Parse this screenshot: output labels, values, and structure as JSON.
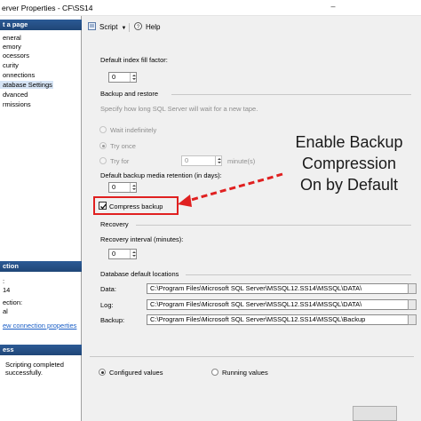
{
  "window": {
    "title": "erver Properties - CF\\SS14",
    "minimize_glyph": "‒"
  },
  "left_pane": {
    "select_page_header": "t a page",
    "pages": [
      "eneral",
      "emory",
      "ocessors",
      "curity",
      "onnections",
      "atabase Settings",
      "dvanced",
      "rmissions"
    ],
    "selected_index": 5,
    "connection_header": "ction",
    "connection_lines": [
      ":",
      "14",
      "ection:",
      "al"
    ],
    "view_connection_link": "ew connection properties",
    "progress_header": "ess",
    "progress_status": "Scripting completed successfully."
  },
  "toolbar": {
    "script_label": "Script",
    "help_label": "Help"
  },
  "settings": {
    "fill_factor_label": "Default index fill factor:",
    "fill_factor_value": "0",
    "backup_restore_group": "Backup and restore",
    "backup_restore_hint": "Specify how long SQL Server will wait for a new tape.",
    "radio_wait_indefinitely": "Wait indefinitely",
    "radio_try_once": "Try once",
    "radio_try_for": "Try for",
    "try_for_value": "0",
    "try_for_unit": "minute(s)",
    "retention_label": "Default backup media retention (in days):",
    "retention_value": "0",
    "compress_backup_label": "Compress backup",
    "compress_backup_checked": true,
    "recovery_group": "Recovery",
    "recovery_interval_label": "Recovery interval (minutes):",
    "recovery_interval_value": "0",
    "db_locations_group": "Database default locations",
    "data_label": "Data:",
    "data_path": "C:\\Program Files\\Microsoft SQL Server\\MSSQL12.SS14\\MSSQL\\DATA\\",
    "log_label": "Log:",
    "log_path": "C:\\Program Files\\Microsoft SQL Server\\MSSQL12.SS14\\MSSQL\\DATA\\",
    "backup_label": "Backup:",
    "backup_path": "C:\\Program Files\\Microsoft SQL Server\\MSSQL12.SS14\\MSSQL\\Backup",
    "configured_values": "Configured values",
    "running_values": "Running values"
  },
  "annotation": {
    "lines": [
      "Enable Backup",
      "Compression",
      "On by Default"
    ],
    "arrow_color": "#e02020"
  },
  "colors": {
    "header_blue": "#2c5a95",
    "highlight_red": "#e02020",
    "link_blue": "#1a5ec6"
  }
}
